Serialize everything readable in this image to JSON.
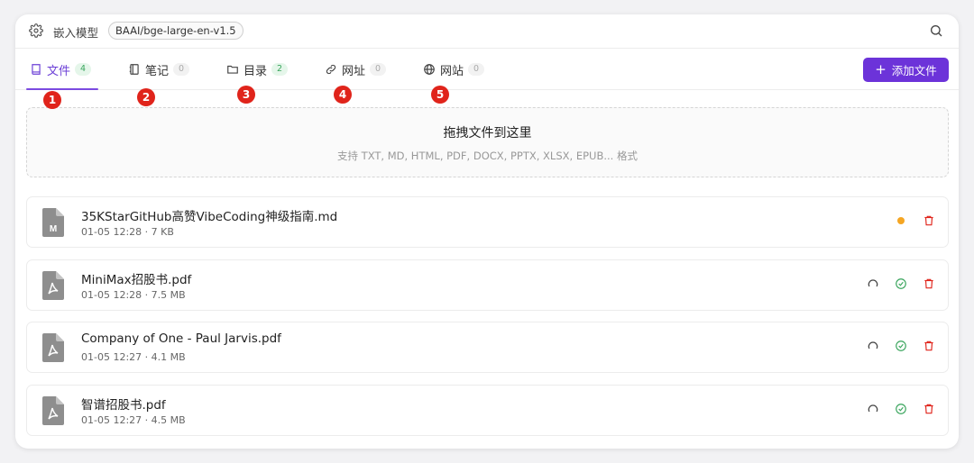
{
  "header": {
    "model_label": "嵌入模型",
    "model_value": "BAAI/bge-large-en-v1.5"
  },
  "tabs": [
    {
      "label": "文件",
      "count": "4",
      "icon": "book-icon",
      "active": true
    },
    {
      "label": "笔记",
      "count": "0",
      "icon": "notebook-icon",
      "active": false
    },
    {
      "label": "目录",
      "count": "2",
      "icon": "folder-icon",
      "active": false
    },
    {
      "label": "网址",
      "count": "0",
      "icon": "link-icon",
      "active": false
    },
    {
      "label": "网站",
      "count": "0",
      "icon": "globe-icon",
      "active": false
    }
  ],
  "markers": [
    "1",
    "2",
    "3",
    "4",
    "5"
  ],
  "add_button": {
    "label": "添加文件"
  },
  "dropzone": {
    "title": "拖拽文件到这里",
    "subtitle": "支持 TXT, MD, HTML, PDF, DOCX, PPTX, XLSX, EPUB... 格式"
  },
  "files": [
    {
      "name": "35KStarGitHub高赞VibeCoding神级指南.md",
      "meta": "01-05 12:28 · 7 KB",
      "type": "md",
      "status": "processing"
    },
    {
      "name": "MiniMax招股书.pdf",
      "meta": "01-05 12:28 · 7.5 MB",
      "type": "pdf",
      "status": "done"
    },
    {
      "name": "Company of One - Paul Jarvis.pdf",
      "meta": "01-05 12:27 · 4.1 MB",
      "type": "pdf",
      "status": "done"
    },
    {
      "name": "智谱招股书.pdf",
      "meta": "01-05 12:27 · 4.5 MB",
      "type": "pdf",
      "status": "done"
    }
  ],
  "colors": {
    "accent": "#6c33d9",
    "success": "#3aa55d",
    "pending": "#f5a623",
    "danger": "#e0241b"
  }
}
